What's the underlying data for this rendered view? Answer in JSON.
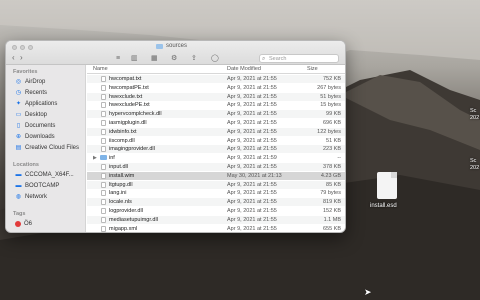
{
  "window": {
    "title": "sources",
    "search_placeholder": "Search"
  },
  "sidebar": {
    "favorites_label": "Favorites",
    "favorites": [
      "AirDrop",
      "Recents",
      "Applications",
      "Desktop",
      "Documents",
      "Downloads",
      "Creative Cloud Files"
    ],
    "locations_label": "Locations",
    "locations": [
      "CCCOMA_X64F...",
      "BOOTCAMP",
      "Network"
    ],
    "tags_label": "Tags",
    "tags": [
      "Ö6"
    ]
  },
  "list": {
    "headers": {
      "name": "Name",
      "date": "Date Modified",
      "size": "Size"
    },
    "rows": [
      {
        "name": "hwcompat.txt",
        "date": "Apr 9, 2021 at 21:55",
        "size": "752 KB",
        "kind": "file"
      },
      {
        "name": "hwcompatPE.txt",
        "date": "Apr 9, 2021 at 21:55",
        "size": "267 bytes",
        "kind": "file"
      },
      {
        "name": "hwexclude.txt",
        "date": "Apr 9, 2021 at 21:55",
        "size": "51 bytes",
        "kind": "file"
      },
      {
        "name": "hwexcludePE.txt",
        "date": "Apr 9, 2021 at 21:55",
        "size": "15 bytes",
        "kind": "file"
      },
      {
        "name": "hypervcomplcheck.dll",
        "date": "Apr 9, 2021 at 21:55",
        "size": "99 KB",
        "kind": "file"
      },
      {
        "name": "iasmigplugin.dll",
        "date": "Apr 9, 2021 at 21:55",
        "size": "696 KB",
        "kind": "file"
      },
      {
        "name": "idwbinfo.txt",
        "date": "Apr 9, 2021 at 21:55",
        "size": "122 bytes",
        "kind": "file"
      },
      {
        "name": "iiscomp.dll",
        "date": "Apr 9, 2021 at 21:55",
        "size": "51 KB",
        "kind": "file"
      },
      {
        "name": "imagingprovider.dll",
        "date": "Apr 9, 2021 at 21:55",
        "size": "223 KB",
        "kind": "file"
      },
      {
        "name": "inf",
        "date": "Apr 9, 2021 at 21:59",
        "size": "--",
        "kind": "folder"
      },
      {
        "name": "input.dll",
        "date": "Apr 9, 2021 at 21:55",
        "size": "378 KB",
        "kind": "file"
      },
      {
        "name": "install.wim",
        "date": "May 30, 2021 at 21:13",
        "size": "4.23 GB",
        "kind": "file",
        "selected": true
      },
      {
        "name": "ltgtupg.dll",
        "date": "Apr 9, 2021 at 21:55",
        "size": "85 KB",
        "kind": "file"
      },
      {
        "name": "lang.ini",
        "date": "Apr 9, 2021 at 21:55",
        "size": "79 bytes",
        "kind": "file"
      },
      {
        "name": "locale.nls",
        "date": "Apr 9, 2021 at 21:55",
        "size": "819 KB",
        "kind": "file"
      },
      {
        "name": "logprovider.dll",
        "date": "Apr 9, 2021 at 21:55",
        "size": "152 KB",
        "kind": "file"
      },
      {
        "name": "mediasetupuimgr.dll",
        "date": "Apr 9, 2021 at 21:55",
        "size": "1.1 MB",
        "kind": "file"
      },
      {
        "name": "migapp.xml",
        "date": "Apr 9, 2021 at 21:55",
        "size": "655 KB",
        "kind": "file"
      }
    ]
  },
  "desktop": {
    "file_label": "install.esd",
    "edge_labels": [
      "Sc\n202",
      "Sc\n202"
    ]
  }
}
